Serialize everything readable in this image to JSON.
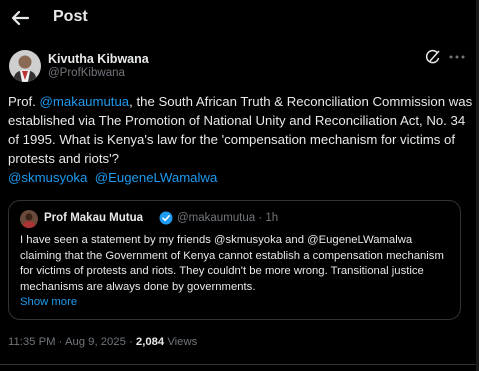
{
  "header": {
    "title": "Post"
  },
  "author": {
    "name": "Kivutha Kibwana",
    "handle": "@ProfKibwana"
  },
  "tweet": {
    "t1": "Prof. ",
    "m1": "@makaumutua",
    "t2": ", the South African Truth & Reconciliation Commission was established via The Promotion of National Unity and Reconciliation Act, No. 34 of 1995. What is Kenya's  law for the 'compensation mechanism for victims of protests and riots'?",
    "m2": "@skmusyoka",
    "m3": "@EugeneLWamalwa"
  },
  "quote": {
    "name": "Prof Makau Mutua",
    "handle": "@makaumutua",
    "time": "· 1h",
    "text": "I have seen a statement by my friends @skmusyoka and @EugeneLWamalwa claiming that the Government of Kenya cannot establish a compensation mechanism for victims of protests and riots.  They couldn't be more wrong. Transitional justice mechanisms are always done by governments.",
    "show_more": "Show more"
  },
  "meta": {
    "time": "11:35 PM",
    "sep1": " · ",
    "date": "Aug 9, 2025",
    "sep2": " · ",
    "views_count": "2,084",
    "views_label": " Views"
  },
  "colors": {
    "accent": "#1d9bf0",
    "background": "#000000",
    "text": "#e7e9ea",
    "secondary": "#71767b",
    "border": "#2f3336"
  },
  "icons": [
    "back-arrow-icon",
    "grok-icon",
    "more-icon",
    "verified-badge-icon"
  ]
}
